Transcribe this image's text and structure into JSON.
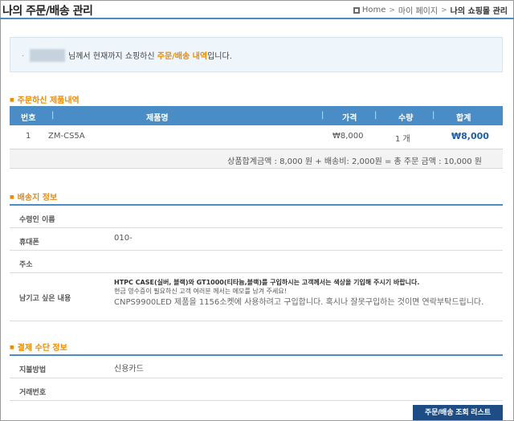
{
  "header": {
    "title": "나의 주문/배송 관리",
    "breadcrumb": {
      "home": "Home",
      "mypage": "마이 페이지",
      "current": "나의 쇼핑몰 관리",
      "separator": ">"
    }
  },
  "notice": {
    "text_before": "님께서 현재까지 쇼핑하신 ",
    "highlight": "주문/배송 내역",
    "text_after": "입니다.",
    "bullet": "·"
  },
  "order_section": {
    "title": "주문하신 제품내역",
    "columns": [
      "번호",
      "제품명",
      "가격",
      "수량",
      "합계"
    ],
    "divider": "|",
    "rows": [
      {
        "no": "1",
        "product": "ZM-CS5A",
        "price": "₩8,000",
        "qty": "1 개",
        "total": "₩8,000"
      }
    ],
    "summary": "상품합계금액 : 8,000 원 + 배송비: 2,000원 = 총 주문 금액 : 10,000 원"
  },
  "shipping_section": {
    "title": "배송지 정보",
    "recipient_label": "수령인 이름",
    "recipient_value": "",
    "phone_label": "휴대폰",
    "phone_value": "010-",
    "address_label": "주소",
    "address_value": "",
    "memo_label": "남기고 싶은 내용",
    "memo_notice_1": "HTPC CASE(실버, 블랙)와 GT1000(티타늄,블랙)를 구입하시는 고객께서는 색상을 기입해 주시기 바랍니다.",
    "memo_notice_2": "현금 영수증이 필요하신 고객 여러분 께서는 메모를 남겨 주세요!",
    "memo_body": "CNPS9900LED 제품을 1156소켓에 사용하려고 구입합니다. 혹시나 잘못구입하는 것이면 연락부탁드립니다."
  },
  "payment_section": {
    "title": "결제 수단 정보",
    "method_label": "지불방법",
    "method_value": "신용카드",
    "txn_label": "거래번호",
    "txn_value": ""
  },
  "actions": {
    "list_button": "주문/배송 조회 리스트"
  },
  "colors": {
    "accent": "#4a8cc6",
    "orange": "#f08a00",
    "button": "#1e4d86"
  }
}
